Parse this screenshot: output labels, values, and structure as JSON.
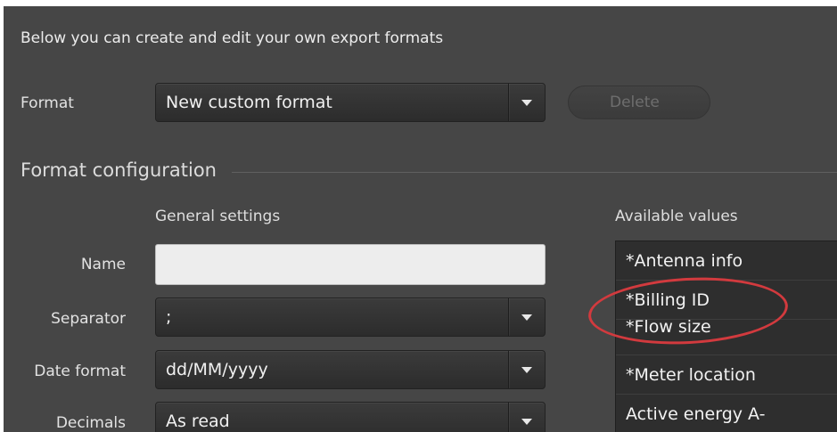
{
  "intro_text": "Below you can create and edit your own export formats",
  "format": {
    "label": "Format",
    "selected": "New custom format",
    "delete_label": "Delete"
  },
  "configuration": {
    "title": "Format configuration",
    "general_settings_header": "General settings",
    "available_values_header": "Available values",
    "fields": {
      "name": {
        "label": "Name",
        "value": ""
      },
      "separator": {
        "label": "Separator",
        "selected": ";"
      },
      "date_format": {
        "label": "Date format",
        "selected": "dd/MM/yyyy"
      },
      "decimals": {
        "label": "Decimals",
        "selected": "As read"
      }
    },
    "available_values": [
      "*Antenna info",
      "*Billing ID",
      "*Flow size",
      "*Meter location",
      "Active energy A-"
    ]
  },
  "colors": {
    "background": "#464646",
    "highlight_circle": "#d23a3e",
    "input_background": "#ededed"
  }
}
